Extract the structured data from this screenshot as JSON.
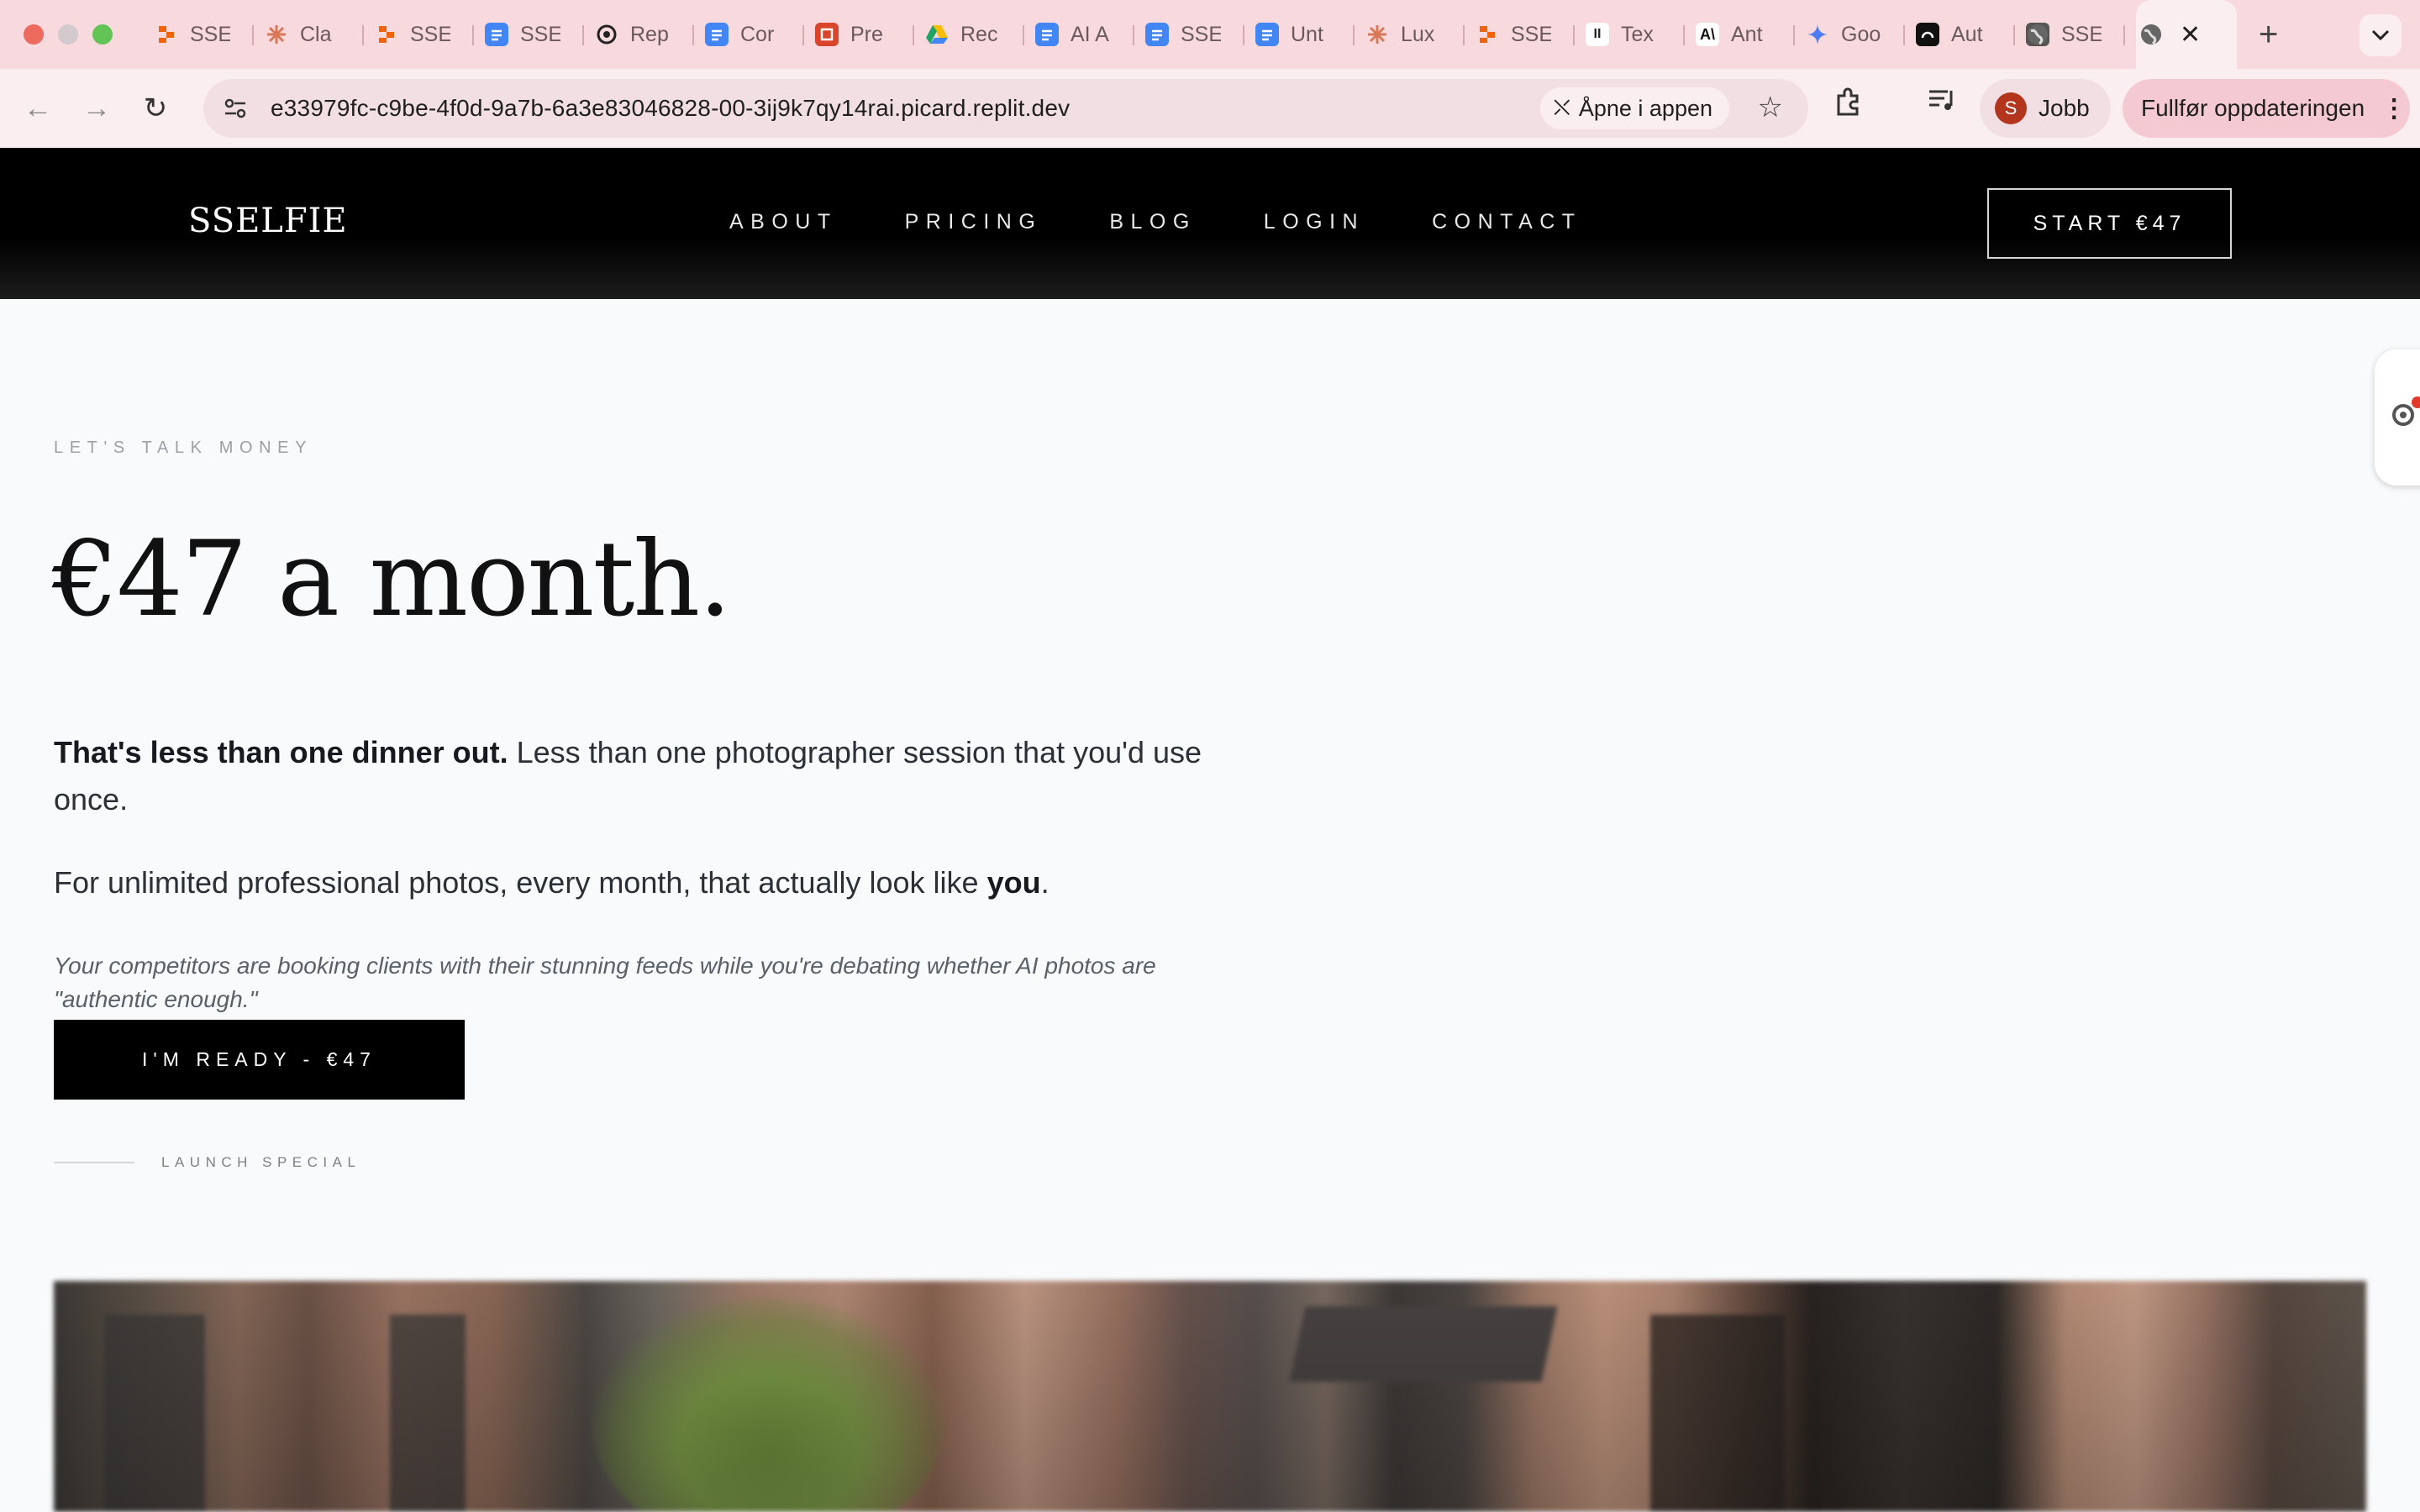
{
  "browser": {
    "tabs": [
      {
        "title": "SSE",
        "icon": "replit-icon",
        "color": "#f26207"
      },
      {
        "title": "Cla",
        "icon": "claude-icon",
        "color": "#d97757"
      },
      {
        "title": "SSE",
        "icon": "replit-icon",
        "color": "#f26207"
      },
      {
        "title": "SSE",
        "icon": "docs-icon",
        "color": "#4285f4"
      },
      {
        "title": "Rep",
        "icon": "openai-icon",
        "color": "#222222"
      },
      {
        "title": "Cor",
        "icon": "docs-icon",
        "color": "#4285f4"
      },
      {
        "title": "Pre",
        "icon": "slides-icon",
        "color": "#d9452b"
      },
      {
        "title": "Rec",
        "icon": "drive-icon",
        "color": "#1fa463"
      },
      {
        "title": "AI A",
        "icon": "docs-icon",
        "color": "#4285f4"
      },
      {
        "title": "SSE",
        "icon": "docs-icon",
        "color": "#4285f4"
      },
      {
        "title": "Unt",
        "icon": "docs-icon",
        "color": "#4285f4"
      },
      {
        "title": "Lux",
        "icon": "claude-icon",
        "color": "#d97757"
      },
      {
        "title": "SSE",
        "icon": "replit-icon",
        "color": "#f26207"
      },
      {
        "title": "Tex",
        "icon": "pause-icon",
        "color": "#ffffff"
      },
      {
        "title": "Ant",
        "icon": "anthropic-icon",
        "color": "#ffffff"
      },
      {
        "title": "Goo",
        "icon": "gemini-icon",
        "color": "#4e7cf5"
      },
      {
        "title": "Aut",
        "icon": "circle-logo-icon",
        "color": "#111111"
      },
      {
        "title": "SSE",
        "icon": "globe-icon",
        "color": "#555555"
      }
    ],
    "active_tab_close": "✕",
    "new_tab": "+",
    "url": "e33979fc-c9be-4f0d-9a7b-6a3e83046828-00-3ij9k7qy14rai.picard.replit.dev",
    "open_in_app": "Åpne i appen",
    "profile_initial": "S",
    "profile_name": "Jobb",
    "update_label": "Fullfør oppdateringen"
  },
  "site": {
    "logo": "SSELFIE",
    "nav": [
      "ABOUT",
      "PRICING",
      "BLOG",
      "LOGIN",
      "CONTACT"
    ],
    "cta": "START €47"
  },
  "main": {
    "eyebrow": "LET'S TALK MONEY",
    "headline": "€47 a month.",
    "lead_bold": "That's less than one dinner out.",
    "lead_rest": " Less than one photographer session that you'd use once.",
    "para2_start": "For unlimited professional photos, every month, that actually look like ",
    "para2_bold": "you",
    "para2_end": ".",
    "quote": "Your competitors are booking clients with their stunning feeds while you're debating whether AI photos are \"authentic enough.\"",
    "button": "I'M READY - €47",
    "special": "LAUNCH SPECIAL"
  }
}
